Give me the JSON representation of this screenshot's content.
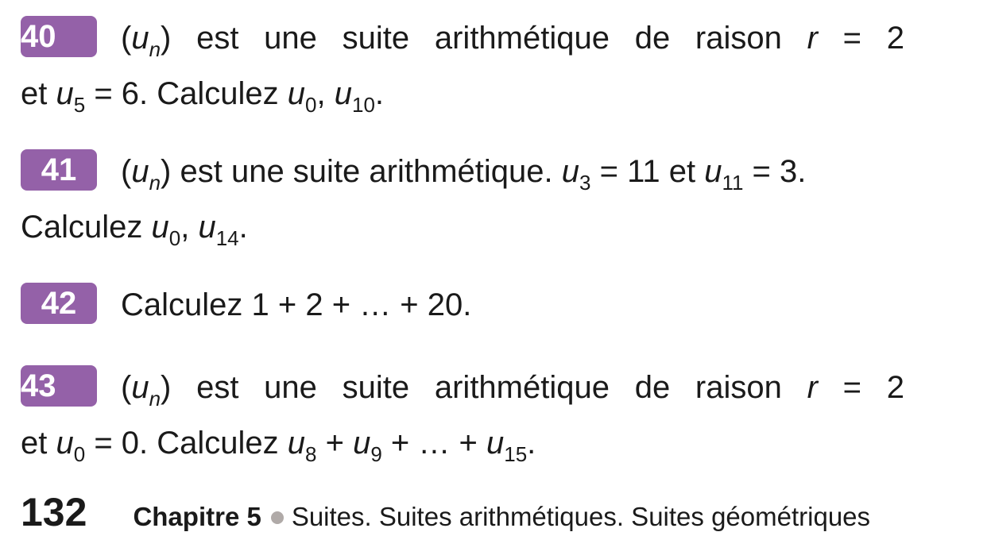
{
  "exercises": [
    {
      "number": "40",
      "line1": {
        "a": "(",
        "u": "u",
        "n": "n",
        "b": ") est une suite arithmétique de raison ",
        "r": "r",
        "c": " = 2"
      },
      "line2": {
        "a": "et ",
        "u": "u",
        "s1": "5",
        "b": " = 6. Calculez ",
        "u2": "u",
        "s2": "0",
        "c": ", ",
        "u3": "u",
        "s3": "10",
        "d": "."
      }
    },
    {
      "number": "41",
      "line1": {
        "a": "(",
        "u": "u",
        "n": "n",
        "b": ") est une suite arithmétique. ",
        "u2": "u",
        "s2": "3",
        "c": " = 11 et ",
        "u3": "u",
        "s3": "11",
        "d": " = 3."
      },
      "line2": {
        "a": "Calculez ",
        "u": "u",
        "s1": "0",
        "b": ", ",
        "u2": "u",
        "s2": "14",
        "c": "."
      }
    },
    {
      "number": "42",
      "line1": {
        "a": "Calculez 1 + 2 + … + 20."
      }
    },
    {
      "number": "43",
      "line1": {
        "a": "(",
        "u": "u",
        "n": "n",
        "b": ") est une suite arithmétique de raison ",
        "r": "r",
        "c": " = 2"
      },
      "line2": {
        "a": "et ",
        "u": "u",
        "s1": "0",
        "b": " = 0. Calculez ",
        "u2": "u",
        "s2": "8",
        "c": " + ",
        "u3": "u",
        "s3": "9",
        "d": " + … + ",
        "u4": "u",
        "s4": "15",
        "e": "."
      }
    }
  ],
  "footer": {
    "page_number": "132",
    "chapter": "Chapitre 5",
    "subtitle": "Suites. Suites arithmétiques. Suites géométriques"
  },
  "colors": {
    "badge": "#9461a8",
    "dot": "#b0aaa8"
  }
}
